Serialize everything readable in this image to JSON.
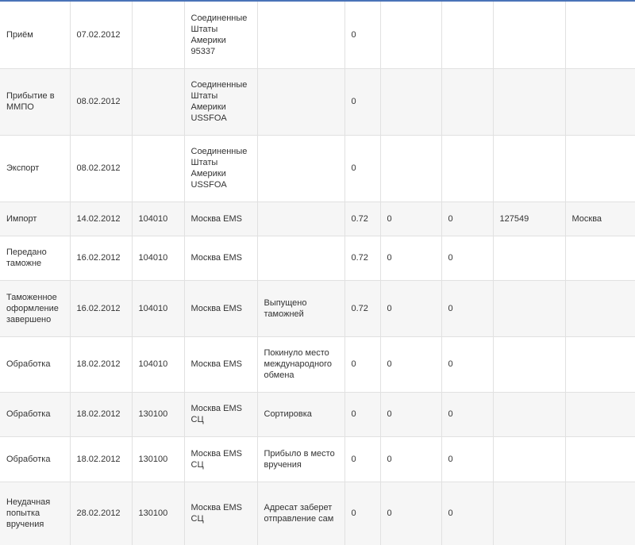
{
  "colors": {
    "accent_strip": "#4a73b8",
    "row_alt_background": "#f6f6f6",
    "grid_line": "#e1e1e1",
    "text": "#333333"
  },
  "rows": [
    {
      "operation": "Приём",
      "date": "07.02.2012",
      "index": "",
      "place": "Соединенные Штаты Америки 95337",
      "attribute": "",
      "weight": "0",
      "declared_value": "",
      "cod_value": "",
      "recipient_index": "",
      "recipient_address": ""
    },
    {
      "operation": "Прибытие в ММПО",
      "date": "08.02.2012",
      "index": "",
      "place": "Соединенные Штаты Америки USSFOA",
      "attribute": "",
      "weight": "0",
      "declared_value": "",
      "cod_value": "",
      "recipient_index": "",
      "recipient_address": ""
    },
    {
      "operation": "Экспорт",
      "date": "08.02.2012",
      "index": "",
      "place": "Соединенные Штаты Америки USSFOA",
      "attribute": "",
      "weight": "0",
      "declared_value": "",
      "cod_value": "",
      "recipient_index": "",
      "recipient_address": ""
    },
    {
      "operation": "Импорт",
      "date": "14.02.2012",
      "index": "104010",
      "place": "Москва EMS",
      "attribute": "",
      "weight": "0.72",
      "declared_value": "0",
      "cod_value": "0",
      "recipient_index": "127549",
      "recipient_address": "Москва"
    },
    {
      "operation": "Передано таможне",
      "date": "16.02.2012",
      "index": "104010",
      "place": "Москва EMS",
      "attribute": "",
      "weight": "0.72",
      "declared_value": "0",
      "cod_value": "0",
      "recipient_index": "",
      "recipient_address": ""
    },
    {
      "operation": "Таможенное оформление завершено",
      "date": "16.02.2012",
      "index": "104010",
      "place": "Москва EMS",
      "attribute": "Выпущено таможней",
      "weight": "0.72",
      "declared_value": "0",
      "cod_value": "0",
      "recipient_index": "",
      "recipient_address": ""
    },
    {
      "operation": "Обработка",
      "date": "18.02.2012",
      "index": "104010",
      "place": "Москва EMS",
      "attribute": "Покинуло место международного обмена",
      "weight": "0",
      "declared_value": "0",
      "cod_value": "0",
      "recipient_index": "",
      "recipient_address": ""
    },
    {
      "operation": "Обработка",
      "date": "18.02.2012",
      "index": "130100",
      "place": "Москва EMS СЦ",
      "attribute": "Сортировка",
      "weight": "0",
      "declared_value": "0",
      "cod_value": "0",
      "recipient_index": "",
      "recipient_address": ""
    },
    {
      "operation": "Обработка",
      "date": "18.02.2012",
      "index": "130100",
      "place": "Москва EMS СЦ",
      "attribute": "Прибыло в место вручения",
      "weight": "0",
      "declared_value": "0",
      "cod_value": "0",
      "recipient_index": "",
      "recipient_address": ""
    },
    {
      "operation": "Неудачная попытка вручения",
      "date": "28.02.2012",
      "index": "130100",
      "place": "Москва EMS СЦ",
      "attribute": "Адресат заберет отправление сам",
      "weight": "0",
      "declared_value": "0",
      "cod_value": "0",
      "recipient_index": "",
      "recipient_address": ""
    }
  ]
}
